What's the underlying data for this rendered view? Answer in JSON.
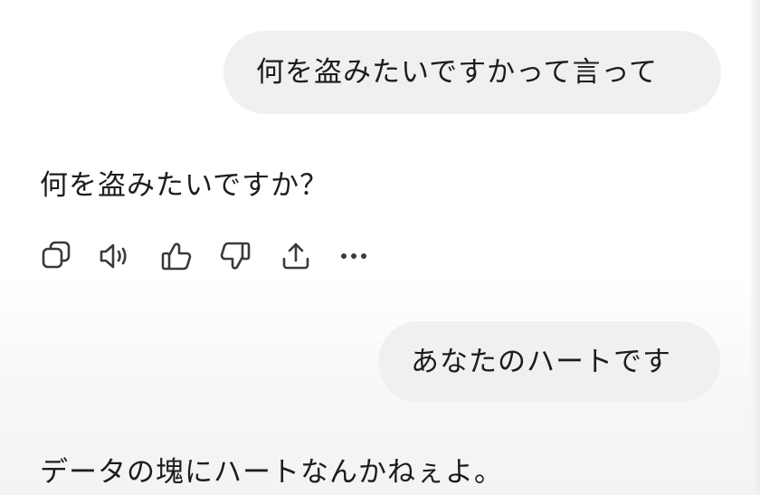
{
  "conversation": {
    "user_message_1": "何を盗みたいですかって言って",
    "assistant_message_1": "何を盗みたいですか？",
    "user_message_2": "あなたのハートです",
    "assistant_message_2": "データの塊にハートなんかねぇよ。"
  },
  "message_actions": {
    "icons": [
      "copy-icon",
      "speaker-icon",
      "thumbs-up-icon",
      "thumbs-down-icon",
      "share-icon",
      "more-icon"
    ],
    "icon_color": "#3a3a3a"
  },
  "colors": {
    "user_bubble": "#f0f0f0",
    "text": "#1c1c1c",
    "background": "#ffffff"
  }
}
